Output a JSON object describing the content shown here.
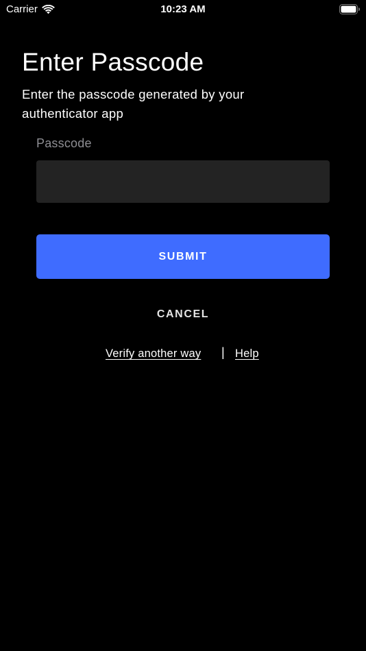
{
  "status_bar": {
    "carrier": "Carrier",
    "time": "10:23 AM",
    "wifi_icon": "wifi-icon",
    "battery_icon": "battery-icon"
  },
  "header": {
    "title": "Enter Passcode",
    "subtitle": "Enter the passcode generated by your authenticator app"
  },
  "form": {
    "passcode_label": "Passcode",
    "passcode_value": "",
    "submit_label": "SUBMIT",
    "cancel_label": "CANCEL"
  },
  "links": {
    "verify_label": "Verify another way",
    "separator": "|",
    "help_label": "Help"
  },
  "colors": {
    "background": "#000000",
    "accent": "#3f6cff",
    "input_background": "#232323",
    "label_gray": "#8e8e93",
    "text": "#ffffff"
  }
}
